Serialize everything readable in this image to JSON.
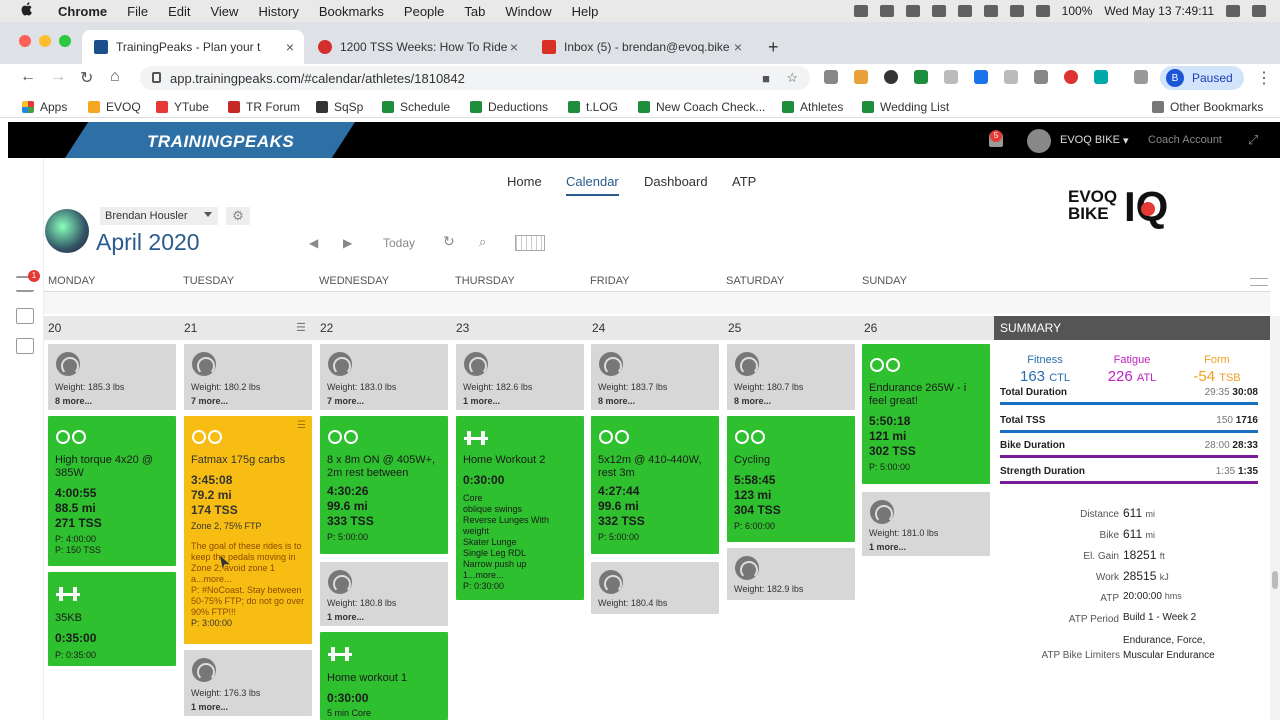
{
  "mac_menu": {
    "app": "Chrome",
    "items": [
      "File",
      "Edit",
      "View",
      "History",
      "Bookmarks",
      "People",
      "Tab",
      "Window",
      "Help"
    ],
    "battery": "100%",
    "datetime": "Wed May 13  7:49:11"
  },
  "tabs": [
    {
      "title": "TrainingPeaks - Plan your t",
      "color": "#1a4f8b"
    },
    {
      "title": "1200 TSS Weeks: How To Ride",
      "color": "#d32f2f"
    },
    {
      "title": "Inbox (5) - brendan@evoq.bike",
      "color": "#d93025"
    }
  ],
  "url": "app.trainingpeaks.com/#calendar/athletes/1810842",
  "profile": {
    "initial": "B",
    "label": "Paused"
  },
  "bookmarks": [
    "Apps",
    "EVOQ",
    "YTube",
    "TR Forum",
    "SqSp",
    "Schedule",
    "Deductions",
    "t.LOG",
    "New Coach Check...",
    "Athletes",
    "Wedding List"
  ],
  "other_bookmarks": "Other Bookmarks",
  "tp": {
    "logo": "TRAININGPEAKS",
    "notif": "5",
    "user": "EVOQ BIKE",
    "coach": "Coach Account",
    "nav": [
      "Home",
      "Calendar",
      "Dashboard",
      "ATP"
    ],
    "athlete": "Brendan Housler",
    "month": "April 2020",
    "today": "Today",
    "left_badge": "1",
    "brand_top": "EVOQ",
    "brand_bottom": "BIKE",
    "brand_iq": "IQ"
  },
  "days": [
    "MONDAY",
    "TUESDAY",
    "WEDNESDAY",
    "THURSDAY",
    "FRIDAY",
    "SATURDAY",
    "SUNDAY"
  ],
  "dates": [
    "20",
    "21",
    "22",
    "23",
    "24",
    "25",
    "26"
  ],
  "cards": {
    "mon_w": {
      "weight": "Weight: 185.3 lbs",
      "more": "8 more..."
    },
    "mon_1": {
      "title": "High torque 4x20 @ 385W",
      "dur": "4:00:55",
      "dist": "88.5 mi",
      "tss": "271 TSS",
      "p1": "P: 4:00:00",
      "p2": "P: 150 TSS"
    },
    "mon_2": {
      "title": "35KB",
      "dur": "0:35:00",
      "p1": "P: 0:35:00"
    },
    "tue_w": {
      "weight": "Weight: 180.2 lbs",
      "more": "7 more..."
    },
    "tue_1": {
      "title": "Fatmax 175g carbs",
      "dur": "3:45:08",
      "dist": "79.2 mi",
      "tss": "174 TSS",
      "zone": "Zone 2, 75% FTP",
      "desc": "The goal of these rides is to keep the pedals moving in Zone 2; avoid zone 1 a...more...",
      "desc2": "P: #NoCoast. Stay between 50-75% FTP; do not go over 90% FTP!!!",
      "p1": "P: 3:00:00"
    },
    "tue_w2": {
      "weight": "Weight: 176.3 lbs",
      "more": "1 more..."
    },
    "wed_w": {
      "weight": "Weight: 183.0 lbs",
      "more": "7 more..."
    },
    "wed_1": {
      "title": "8 x 8m ON @ 405W+, 2m rest between",
      "dur": "4:30:26",
      "dist": "99.6 mi",
      "tss": "333 TSS",
      "p1": "P: 5:00:00"
    },
    "wed_w2": {
      "weight": "Weight: 180.8 lbs",
      "more": "1 more..."
    },
    "wed_2": {
      "title": "Home workout 1",
      "dur": "0:30:00",
      "p1": "5 min Core"
    },
    "thu_w": {
      "weight": "Weight: 182.6 lbs",
      "more": "1 more..."
    },
    "thu_1": {
      "title": "Home Workout 2",
      "dur": "0:30:00",
      "lines": [
        "Core",
        "oblique swings",
        "Reverse Lunges With weight",
        "Skater Lunge",
        "Single Leg RDL",
        "Narrow push up",
        "1...more..."
      ],
      "p1": "P: 0:30:00"
    },
    "fri_w": {
      "weight": "Weight: 183.7 lbs",
      "more": "8 more..."
    },
    "fri_1": {
      "title": "5x12m @ 410-440W, rest 3m",
      "dur": "4:27:44",
      "dist": "99.6 mi",
      "tss": "332 TSS",
      "p1": "P: 5:00:00"
    },
    "fri_w2": {
      "weight": "Weight: 180.4 lbs"
    },
    "sat_w": {
      "weight": "Weight: 180.7 lbs",
      "more": "8 more..."
    },
    "sat_1": {
      "title": "Cycling",
      "dur": "5:58:45",
      "dist": "123 mi",
      "tss": "304 TSS",
      "p1": "P: 6:00:00"
    },
    "sat_w2": {
      "weight": "Weight: 182.9 lbs"
    },
    "sun_1": {
      "title": "Endurance 265W - i feel great!",
      "dur": "5:50:18",
      "dist": "121 mi",
      "tss": "302 TSS",
      "p1": "P: 5:00:00"
    },
    "sun_w": {
      "weight": "Weight: 181.0 lbs",
      "more": "1 more..."
    }
  },
  "summary": {
    "title": "SUMMARY",
    "fitness": {
      "label": "Fitness",
      "value": "163",
      "unit": "CTL",
      "color": "#2a6db0"
    },
    "fatigue": {
      "label": "Fatigue",
      "value": "226",
      "unit": "ATL",
      "color": "#c020c0"
    },
    "form": {
      "label": "Form",
      "value": "-54",
      "unit": "TSB",
      "color": "#f0a020"
    },
    "rows": [
      {
        "label": "Total Duration",
        "planned": "29:35",
        "actual": "30:08",
        "color": "#1a6fc0"
      },
      {
        "label": "Total TSS",
        "planned": "150",
        "actual": "1716",
        "color": "#1a6fc0"
      },
      {
        "label": "Bike Duration",
        "planned": "28:00",
        "actual": "28:33",
        "color": "#7a1a9a"
      },
      {
        "label": "Strength Duration",
        "planned": "1:35",
        "actual": "1:35",
        "color": "#7a1a9a"
      }
    ],
    "stats": [
      {
        "label": "Distance",
        "value": "611",
        "unit": "mi"
      },
      {
        "label": "Bike",
        "value": "611",
        "unit": "mi"
      },
      {
        "label": "El. Gain",
        "value": "18251",
        "unit": "ft"
      },
      {
        "label": "Work",
        "value": "28515",
        "unit": "kJ"
      },
      {
        "label": "ATP",
        "value": "20:00:00",
        "unit": "hms"
      },
      {
        "label": "ATP Period",
        "value": "Build 1 - Week 2",
        "unit": ""
      },
      {
        "label": "ATP Bike Limiters",
        "value": "Endurance, Force, Muscular Endurance",
        "unit": ""
      }
    ]
  }
}
